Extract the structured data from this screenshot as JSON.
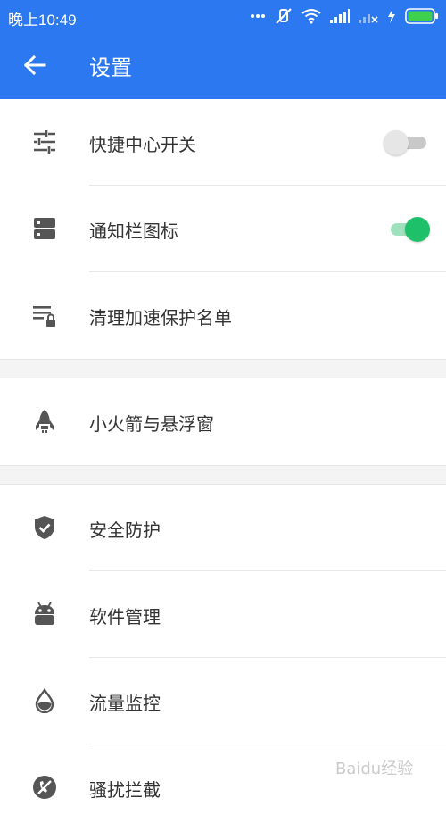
{
  "status_bar": {
    "time": "晚上10:49",
    "icons": [
      "more-dots-icon",
      "mute-icon",
      "wifi-icon",
      "signal-icon",
      "signal-x-icon",
      "charging-icon",
      "battery-icon"
    ]
  },
  "app_bar": {
    "title": "设置",
    "back_icon": "arrow-left-icon",
    "background_color": "#2b78f0"
  },
  "sections": [
    {
      "items": [
        {
          "label": "快捷中心开关",
          "icon": "sliders-icon",
          "toggle": "off"
        },
        {
          "label": "通知栏图标",
          "icon": "notification-bar-icon",
          "toggle": "on"
        },
        {
          "label": "清理加速保护名单",
          "icon": "list-lock-icon"
        }
      ]
    },
    {
      "items": [
        {
          "label": "小火箭与悬浮窗",
          "icon": "rocket-icon"
        }
      ]
    },
    {
      "items": [
        {
          "label": "安全防护",
          "icon": "shield-check-icon"
        },
        {
          "label": "软件管理",
          "icon": "android-icon"
        },
        {
          "label": "流量监控",
          "icon": "water-drop-icon"
        },
        {
          "label": "骚扰拦截",
          "icon": "block-call-icon"
        }
      ]
    }
  ],
  "colors": {
    "accent": "#2b78f0",
    "toggle_on": "#1ec06a",
    "toggle_off": "#c8c8c8",
    "icon": "#555555"
  },
  "watermark": "Baidu经验"
}
